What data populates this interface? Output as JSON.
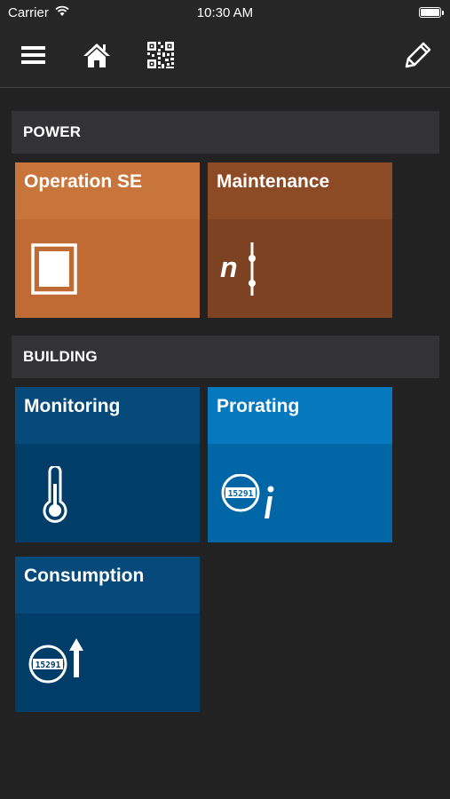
{
  "status_bar": {
    "carrier": "Carrier",
    "time": "10:30 AM"
  },
  "toolbar": {
    "icons": [
      "menu-icon",
      "home-icon",
      "qr-code-icon",
      "edit-pencil-icon"
    ]
  },
  "sections": {
    "power": {
      "title": "POWER",
      "tiles": {
        "operation": {
          "label": "Operation SE",
          "icon": "breaker-frame-icon",
          "head_color": "#C8753B",
          "body_color": "#C06B34"
        },
        "maintenance": {
          "label": "Maintenance",
          "icon": "n-switch-icon",
          "head_color": "#8C4A25",
          "body_color": "#7D4222"
        }
      }
    },
    "building": {
      "title": "BUILDING",
      "tiles": {
        "monitoring": {
          "label": "Monitoring",
          "icon": "thermometer-icon",
          "head_color": "#064A7C",
          "body_color": "#003D68"
        },
        "prorating": {
          "label": "Prorating",
          "icon": "meter-info-icon",
          "head_color": "#0678BE",
          "body_color": "#0066A6"
        },
        "consumption": {
          "label": "Consumption",
          "icon": "meter-up-icon",
          "head_color": "#064A7C",
          "body_color": "#003D68"
        }
      }
    }
  },
  "meter_digits": "15291"
}
